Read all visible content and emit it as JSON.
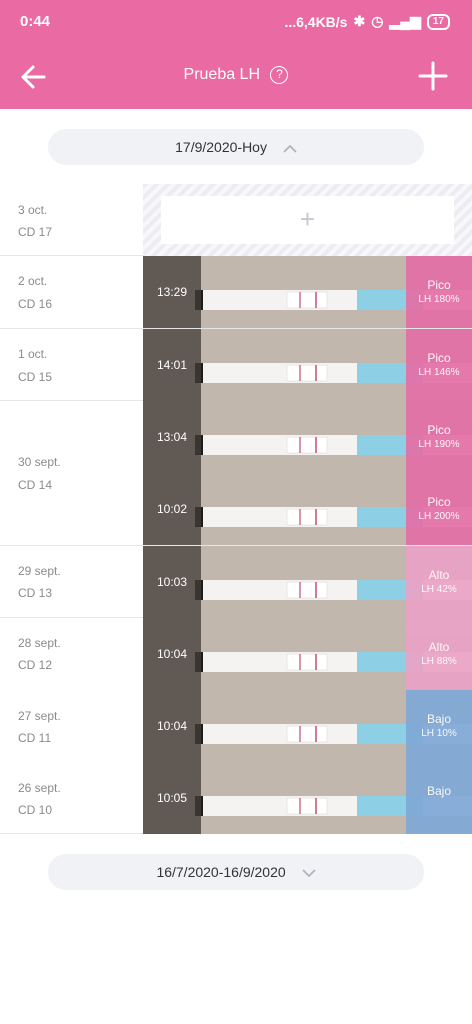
{
  "status": {
    "time": "0:44",
    "network": "...6,4KB/s",
    "battery": "17"
  },
  "header": {
    "title": "Prueba LH",
    "help": "?"
  },
  "range_top": "17/9/2020-Hoy",
  "range_bottom": "16/7/2020-16/9/2020",
  "add_symbol": "+",
  "days": [
    {
      "date": "3 oct.",
      "cd": "CD 17"
    },
    {
      "date": "2 oct.",
      "cd": "CD 16"
    },
    {
      "date": "1 oct.",
      "cd": "CD 15"
    },
    {
      "date": "30 sept.",
      "cd": "CD 14"
    },
    {
      "date": "29 sept.",
      "cd": "CD 13"
    },
    {
      "date": "28 sept.",
      "cd": "CD 12"
    },
    {
      "date": "27 sept.",
      "cd": "CD 11"
    },
    {
      "date": "26 sept.",
      "cd": "CD 10"
    }
  ],
  "tests": [
    {
      "time": "13:29",
      "level": "Pico",
      "value": "LH 180%",
      "color": "#e46fa7"
    },
    {
      "time": "14:01",
      "level": "Pico",
      "value": "LH 146%",
      "color": "#e46fa7"
    },
    {
      "time": "13:04",
      "level": "Pico",
      "value": "LH 190%",
      "color": "#e46fa7"
    },
    {
      "time": "10:02",
      "level": "Pico",
      "value": "LH 200%",
      "color": "#e46fa7"
    },
    {
      "time": "10:03",
      "level": "Alto",
      "value": "LH 42%",
      "color": "#eba2c6"
    },
    {
      "time": "10:04",
      "level": "Alto",
      "value": "LH 88%",
      "color": "#eba2c6"
    },
    {
      "time": "10:04",
      "level": "Bajo",
      "value": "LH 10%",
      "color": "#7fa8d6"
    },
    {
      "time": "10:05",
      "level": "Bajo",
      "value": "",
      "color": "#7fa8d6"
    }
  ]
}
